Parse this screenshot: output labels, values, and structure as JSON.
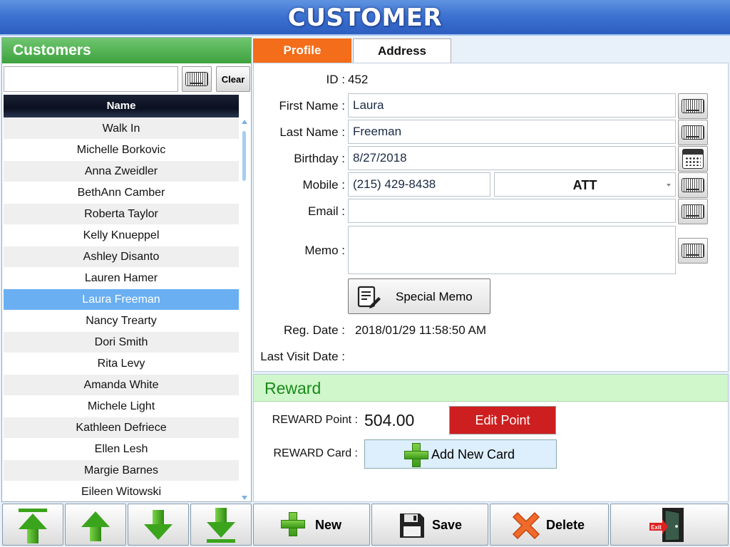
{
  "title": "CUSTOMER",
  "left_panel": {
    "header": "Customers",
    "search_value": "",
    "clear_label": "Clear",
    "column_header": "Name",
    "customers": [
      "Walk In",
      "Michelle Borkovic",
      "Anna Zweidler",
      "BethAnn Camber",
      "Roberta Taylor",
      "Kelly Knueppel",
      "Ashley Disanto",
      "Lauren Hamer",
      "Laura Freeman",
      "Nancy Trearty",
      "Dori Smith",
      "Rita Levy",
      "Amanda White",
      "Michele Light",
      "Kathleen Defriece",
      "Ellen Lesh",
      "Margie Barnes",
      "Eileen Witowski"
    ],
    "selected_index": 8
  },
  "tabs": {
    "profile": "Profile",
    "address": "Address"
  },
  "profile": {
    "id_label": "ID :",
    "id_value": "452",
    "first_name_label": "First Name :",
    "first_name": "Laura",
    "last_name_label": "Last Name :",
    "last_name": "Freeman",
    "birthday_label": "Birthday :",
    "birthday": "8/27/2018",
    "mobile_label": "Mobile :",
    "mobile": "(215) 429-8438",
    "carrier": "ATT",
    "email_label": "Email :",
    "email": "",
    "memo_label": "Memo :",
    "memo": "",
    "special_memo_label": "Special Memo",
    "reg_date_label": "Reg. Date :",
    "reg_date": "2018/01/29 11:58:50 AM",
    "last_visit_label": "Last Visit Date :",
    "last_visit": ""
  },
  "reward": {
    "header": "Reward",
    "point_label": "REWARD Point :",
    "point_value": "504.00",
    "edit_point_label": "Edit Point",
    "card_label": "REWARD Card :",
    "add_card_label": "Add New Card"
  },
  "bottom": {
    "new_label": "New",
    "save_label": "Save",
    "delete_label": "Delete",
    "exit_label": "Exit"
  },
  "colors": {
    "title_blue": "#3c70d0",
    "customers_green": "#4caf50",
    "profile_tab_orange": "#f36d1a",
    "selected_row": "#6aaff2",
    "edit_point_red": "#cd1f1f",
    "reward_header_bg": "#d0f7cc"
  }
}
